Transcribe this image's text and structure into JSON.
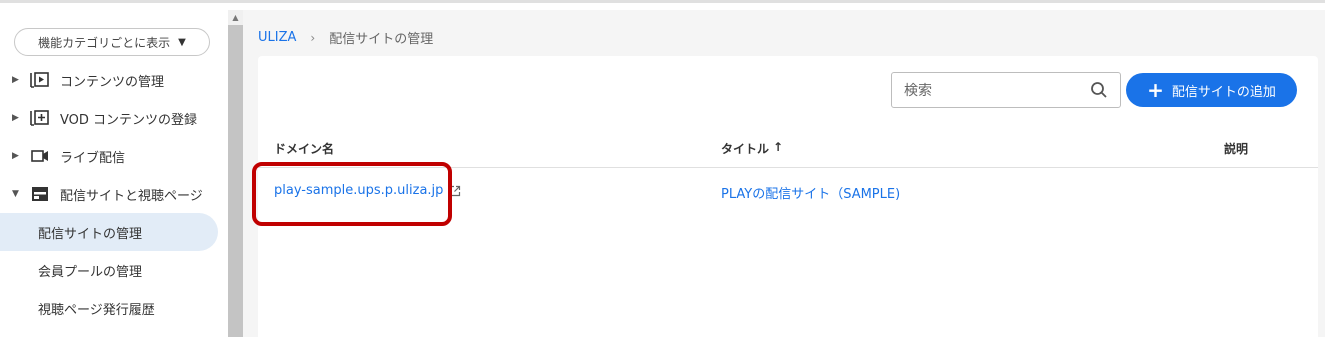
{
  "sidebar": {
    "category_button": "機能カテゴリごとに表示",
    "items": [
      {
        "label": "コンテンツの管理",
        "expanded": false,
        "icon": "play-box-icon"
      },
      {
        "label": "VOD コンテンツの登録",
        "expanded": false,
        "icon": "add-box-icon"
      },
      {
        "label": "ライブ配信",
        "expanded": false,
        "icon": "camera-icon"
      },
      {
        "label": "配信サイトと視聴ページ",
        "expanded": true,
        "icon": "web-window-icon"
      }
    ],
    "subitems": [
      {
        "label": "配信サイトの管理",
        "active": true
      },
      {
        "label": "会員プールの管理",
        "active": false
      },
      {
        "label": "視聴ページ発行履歴",
        "active": false
      }
    ]
  },
  "breadcrumb": {
    "home": "ULIZA",
    "separator": "›",
    "current": "配信サイトの管理"
  },
  "toolbar": {
    "search_placeholder": "検索",
    "add_button": "配信サイトの追加"
  },
  "table": {
    "columns": [
      "ドメイン名",
      "タイトル",
      "説明"
    ],
    "sort_indicator": "↑",
    "rows": [
      {
        "domain": "play-sample.ups.p.uliza.jp",
        "title": "PLAYの配信サイト（SAMPLE)",
        "description": ""
      }
    ]
  },
  "colors": {
    "accent": "#1a73e8",
    "highlight": "#c00000",
    "active_bg": "#e2ecf7"
  }
}
